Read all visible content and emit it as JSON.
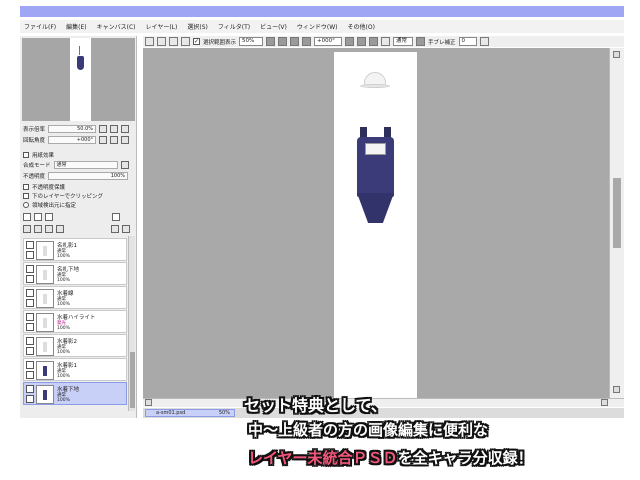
{
  "menu": [
    "ファイル(F)",
    "編集(E)",
    "キャンバス(C)",
    "レイヤー(L)",
    "選択(S)",
    "フィルタ(T)",
    "ビュー(V)",
    "ウィンドウ(W)",
    "その他(O)"
  ],
  "toolbar": {
    "check_label": "選択範囲表示",
    "zoom": "50%",
    "rotation": "+000°",
    "mode": "通常",
    "stabilizer_label": "手ブレ補正",
    "stabilizer_value": "0"
  },
  "left_panel": {
    "zoom_label": "表示倍率",
    "zoom_value": "50.0%",
    "rotation_label": "回転角度",
    "rotation_value": "+000°",
    "paper_effect": "用紙効果",
    "blend_mode_label": "合成モード",
    "blend_mode_value": "通常",
    "opacity_label": "不透明度",
    "opacity_value": "100%",
    "options": [
      "不透明度保護",
      "下のレイヤーでクリッピング",
      "領域検出元に指定"
    ]
  },
  "layers": [
    {
      "name": "名札影1",
      "mode": "通常",
      "opacity": "100%"
    },
    {
      "name": "名札下地",
      "mode": "通常",
      "opacity": "100%"
    },
    {
      "name": "水着線",
      "mode": "通常",
      "opacity": "100%"
    },
    {
      "name": "水着ハイライト",
      "mode": "発光",
      "opacity": "100%"
    },
    {
      "name": "水着影2",
      "mode": "通常",
      "opacity": "100%"
    },
    {
      "name": "水着影1",
      "mode": "通常",
      "opacity": "100%"
    },
    {
      "name": "水着下地",
      "mode": "通常",
      "opacity": "100%"
    }
  ],
  "document_tab": {
    "filename": "a-sm01.psd",
    "zoom": "50%"
  },
  "promo": {
    "line1": "セット特典として、",
    "line2": "中～上級者の方の画像編集に便利な",
    "line3_red": "レイヤー未統合ＰＳＤ",
    "line3_rest": "を全キャラ分収録！"
  },
  "colors": {
    "titlebar": "#9fa6f4",
    "selected_layer": "#c8d0f8",
    "workspace": "#a9a9a9",
    "swimsuit": "#3b3b7a",
    "promo_red": "#f2567a"
  }
}
